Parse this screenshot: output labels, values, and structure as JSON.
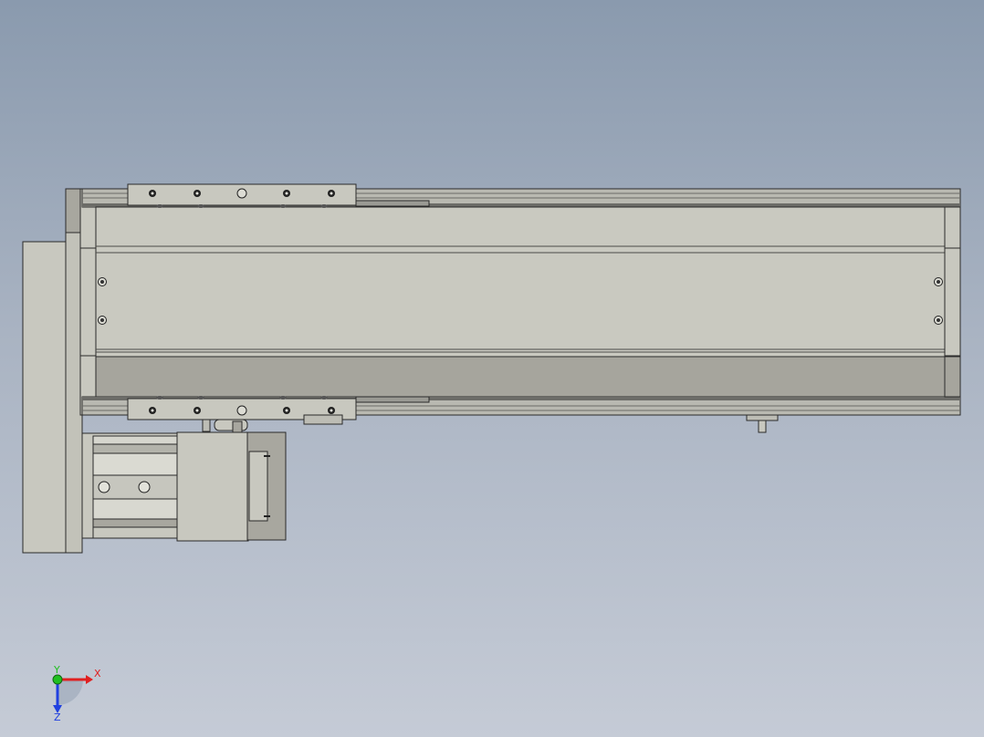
{
  "viewport": {
    "background_top": "#8a9aae",
    "background_bottom": "#c5cbd6"
  },
  "model": {
    "body_color": "#c8c8bf",
    "shade_color": "#a8a79f",
    "dark_color": "#7f7f7a",
    "edge_color": "#2a2a2a"
  },
  "triad": {
    "x_label": "X",
    "y_label": "Y",
    "z_label": "Z",
    "x_color": "#e02020",
    "y_color": "#20c020",
    "z_color": "#2040e0"
  }
}
